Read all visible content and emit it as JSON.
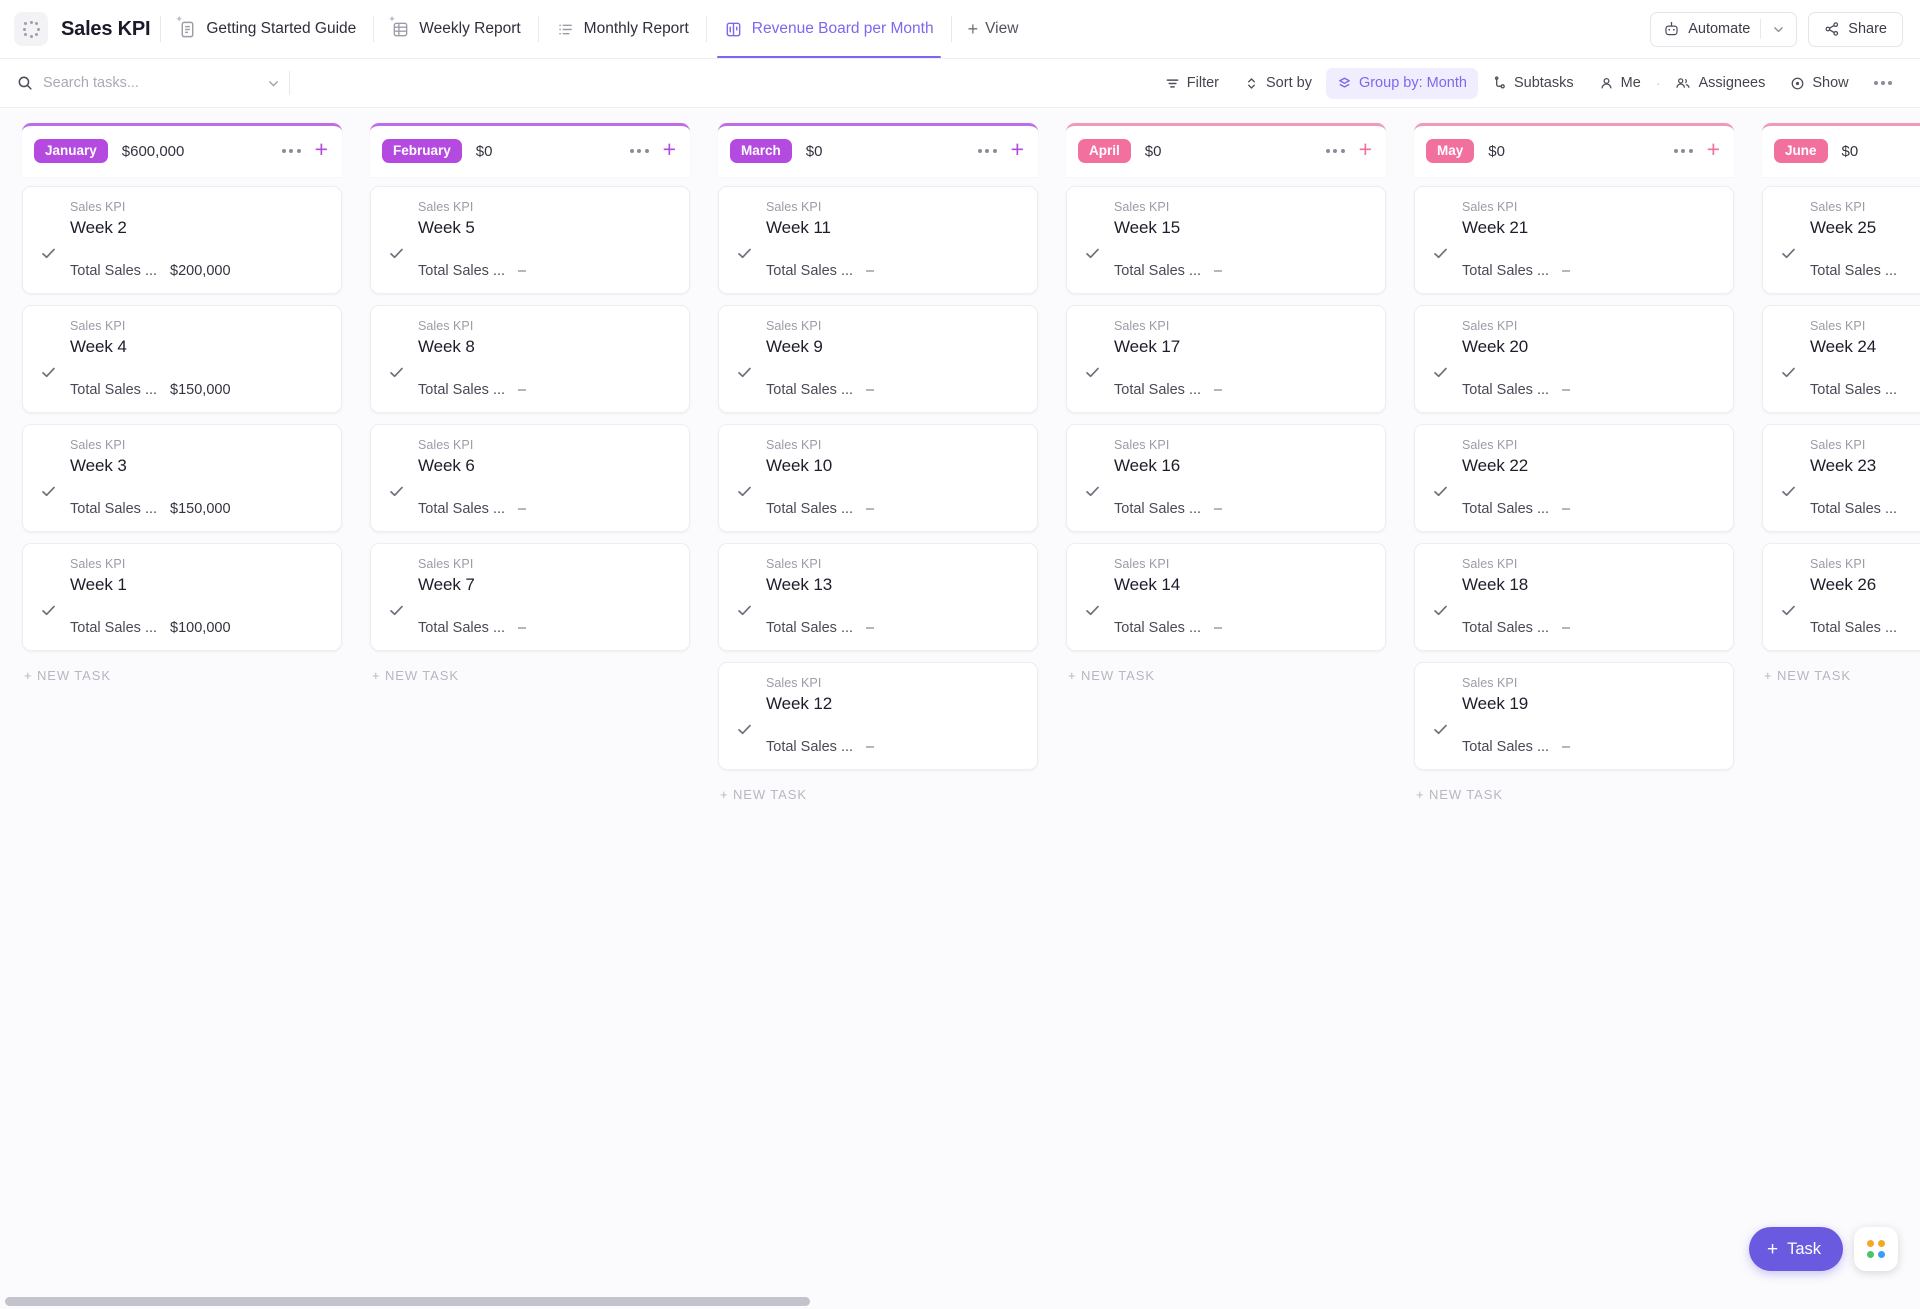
{
  "header": {
    "logo_icon": "clickup-dots-logo",
    "project_title": "Sales KPI",
    "tabs": [
      {
        "label": "Getting Started Guide",
        "icon": "doc-pinned-icon",
        "active": false
      },
      {
        "label": "Weekly Report",
        "icon": "table-pinned-icon",
        "active": false
      },
      {
        "label": "Monthly Report",
        "icon": "list-icon",
        "active": false
      },
      {
        "label": "Revenue Board per Month",
        "icon": "board-icon",
        "active": true
      }
    ],
    "add_view_label": "View",
    "automate_label": "Automate",
    "share_label": "Share"
  },
  "toolbar": {
    "search_placeholder": "Search tasks...",
    "search_value": "",
    "filter_label": "Filter",
    "sort_label": "Sort by",
    "group_label": "Group by: Month",
    "subtasks_label": "Subtasks",
    "me_label": "Me",
    "assignees_label": "Assignees",
    "show_label": "Show"
  },
  "board": {
    "new_task_label": "+ NEW TASK",
    "field_label": "Total Sales ...",
    "list_label": "Sales KPI",
    "empty_value": "–",
    "accent_purple": "#b44ae0",
    "accent_pink": "#f2709e",
    "columns": [
      {
        "month": "January",
        "total": "$600,000",
        "color": "purple",
        "cards": [
          {
            "list": "Sales KPI",
            "title": "Week 2",
            "field": "Total Sales ...",
            "value": "$200,000"
          },
          {
            "list": "Sales KPI",
            "title": "Week 4",
            "field": "Total Sales ...",
            "value": "$150,000"
          },
          {
            "list": "Sales KPI",
            "title": "Week 3",
            "field": "Total Sales ...",
            "value": "$150,000"
          },
          {
            "list": "Sales KPI",
            "title": "Week 1",
            "field": "Total Sales ...",
            "value": "$100,000"
          }
        ]
      },
      {
        "month": "February",
        "total": "$0",
        "color": "purple",
        "cards": [
          {
            "list": "Sales KPI",
            "title": "Week 5",
            "field": "Total Sales ...",
            "value": "–"
          },
          {
            "list": "Sales KPI",
            "title": "Week 8",
            "field": "Total Sales ...",
            "value": "–"
          },
          {
            "list": "Sales KPI",
            "title": "Week 6",
            "field": "Total Sales ...",
            "value": "–"
          },
          {
            "list": "Sales KPI",
            "title": "Week 7",
            "field": "Total Sales ...",
            "value": "–"
          }
        ]
      },
      {
        "month": "March",
        "total": "$0",
        "color": "purple",
        "cards": [
          {
            "list": "Sales KPI",
            "title": "Week 11",
            "field": "Total Sales ...",
            "value": "–"
          },
          {
            "list": "Sales KPI",
            "title": "Week 9",
            "field": "Total Sales ...",
            "value": "–"
          },
          {
            "list": "Sales KPI",
            "title": "Week 10",
            "field": "Total Sales ...",
            "value": "–"
          },
          {
            "list": "Sales KPI",
            "title": "Week 13",
            "field": "Total Sales ...",
            "value": "–"
          },
          {
            "list": "Sales KPI",
            "title": "Week 12",
            "field": "Total Sales ...",
            "value": "–"
          }
        ]
      },
      {
        "month": "April",
        "total": "$0",
        "color": "pink",
        "cards": [
          {
            "list": "Sales KPI",
            "title": "Week 15",
            "field": "Total Sales ...",
            "value": "–"
          },
          {
            "list": "Sales KPI",
            "title": "Week 17",
            "field": "Total Sales ...",
            "value": "–"
          },
          {
            "list": "Sales KPI",
            "title": "Week 16",
            "field": "Total Sales ...",
            "value": "–"
          },
          {
            "list": "Sales KPI",
            "title": "Week 14",
            "field": "Total Sales ...",
            "value": "–"
          }
        ]
      },
      {
        "month": "May",
        "total": "$0",
        "color": "pink",
        "cards": [
          {
            "list": "Sales KPI",
            "title": "Week 21",
            "field": "Total Sales ...",
            "value": "–"
          },
          {
            "list": "Sales KPI",
            "title": "Week 20",
            "field": "Total Sales ...",
            "value": "–"
          },
          {
            "list": "Sales KPI",
            "title": "Week 22",
            "field": "Total Sales ...",
            "value": "–"
          },
          {
            "list": "Sales KPI",
            "title": "Week 18",
            "field": "Total Sales ...",
            "value": "–"
          },
          {
            "list": "Sales KPI",
            "title": "Week 19",
            "field": "Total Sales ...",
            "value": "–"
          }
        ]
      },
      {
        "month": "June",
        "total": "$0",
        "color": "pink",
        "cards": [
          {
            "list": "Sales KPI",
            "title": "Week 25",
            "field": "Total Sales ...",
            "value": ""
          },
          {
            "list": "Sales KPI",
            "title": "Week 24",
            "field": "Total Sales ...",
            "value": ""
          },
          {
            "list": "Sales KPI",
            "title": "Week 23",
            "field": "Total Sales ...",
            "value": ""
          },
          {
            "list": "Sales KPI",
            "title": "Week 26",
            "field": "Total Sales ...",
            "value": ""
          }
        ]
      }
    ]
  },
  "floating": {
    "task_label": "Task",
    "apps_icon": "apps-grid-icon"
  }
}
